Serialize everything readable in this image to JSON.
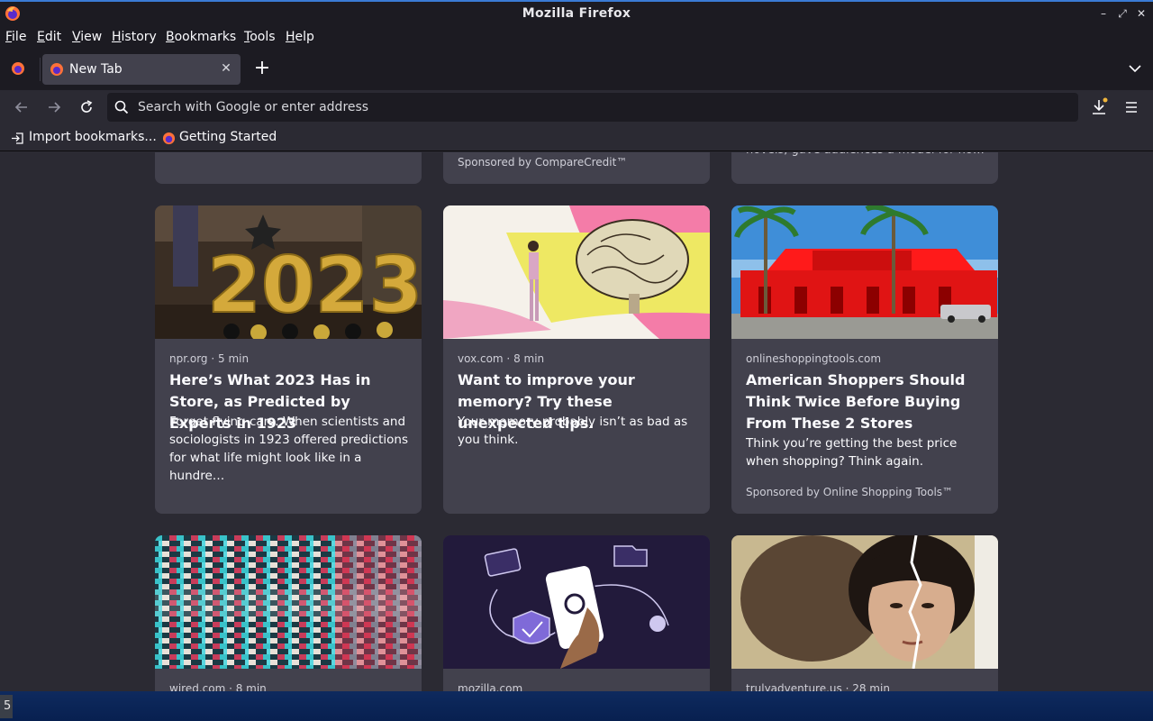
{
  "window": {
    "title": "Mozilla Firefox"
  },
  "menu": {
    "items": [
      "File",
      "Edit",
      "View",
      "History",
      "Bookmarks",
      "Tools",
      "Help"
    ]
  },
  "tabs": {
    "active_label": "New Tab",
    "close_glyph": "✕",
    "new_tab_glyph": "+"
  },
  "urlbar": {
    "placeholder": "Search with Google or enter address"
  },
  "bookmarks": {
    "import_label": "Import bookmarks...",
    "getting_started_label": "Getting Started"
  },
  "top_row": {
    "middle_sponsor": "Sponsored by CompareCredit™",
    "right_excerpt": "novels, gave audiences a model for ho…"
  },
  "cards": [
    {
      "source": "npr.org · 5 min",
      "title": "Here’s What 2023 Has in Store, as Predicted by Experts in 1923",
      "excerpt": "Forget flying cars. When scientists and sociologists in 1923 offered predictions for what life might look like in a hundre…",
      "image": "2023 balloons photo"
    },
    {
      "source": "vox.com · 8 min",
      "title": "Want to improve your memory? Try these unexpected tips.",
      "excerpt": "Your memory probably isn’t as bad as you think.",
      "image": "brain illustration"
    },
    {
      "source": "onlineshoppingtools.com",
      "title": "American Shoppers Should Think Twice Before Buying From These 2 Stores",
      "excerpt": "Think you’re getting the best price when shopping? Think again.",
      "sponsor": "Sponsored by Online Shopping Tools™",
      "image": "red store building"
    }
  ],
  "bottom_row": [
    {
      "source": "wired.com · 8 min",
      "image": "glitch mosaic"
    },
    {
      "source": "mozilla.com",
      "image": "phone illustration"
    },
    {
      "source": "trulyadventure.us · 28 min",
      "image": "torn portrait photo"
    }
  ],
  "taskbar": {
    "item_label": "5"
  },
  "colors": {
    "accent": "#3a7bd5",
    "toolbar": "#1c1b22",
    "content_bg": "#2b2a33",
    "card_bg": "#42414d"
  }
}
